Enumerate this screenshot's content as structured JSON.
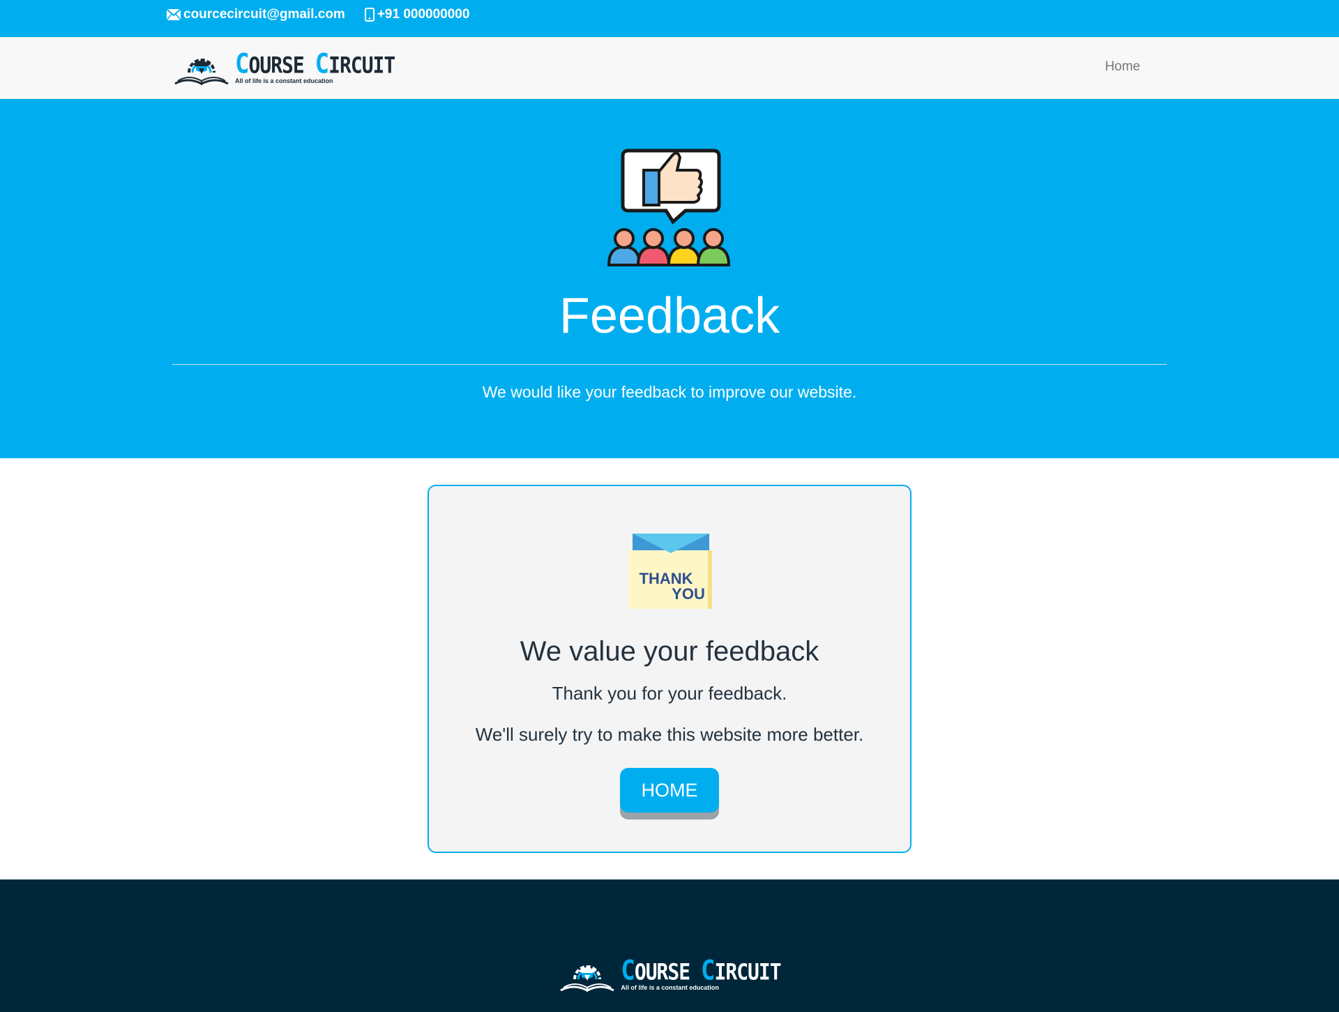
{
  "topbar": {
    "email": "courcecircuit@gmail.com",
    "phone": "+91 000000000"
  },
  "navbar": {
    "logo_first_big": "C",
    "logo_first_rest": "OURSE",
    "logo_second_big": "C",
    "logo_second_rest": "IRCUIT",
    "logo_tagline": "All of life is a constant education",
    "home_link": "Home"
  },
  "hero": {
    "title": "Feedback",
    "subtitle": "We would like your feedback to improve our website."
  },
  "card": {
    "image_text_line1": "THANK",
    "image_text_line2": "YOU",
    "heading": "We value your feedback",
    "line1": "Thank you for your feedback.",
    "line2": "We'll surely try to make this website more better.",
    "button": "HOME"
  },
  "footer": {
    "logo_first_big": "C",
    "logo_first_rest": "OURSE",
    "logo_second_big": "C",
    "logo_second_rest": "IRCUIT",
    "logo_tagline": "All of life is a constant education"
  },
  "colors": {
    "brand_blue": "#00aeef",
    "footer_navy": "#00263a",
    "text_dark": "#24323f"
  },
  "icons": [
    "envelope-icon",
    "mobile-phone-icon",
    "graduation-cap-book-logo-icon",
    "thumbs-up-feedback-icon",
    "thank-you-envelope-icon"
  ]
}
